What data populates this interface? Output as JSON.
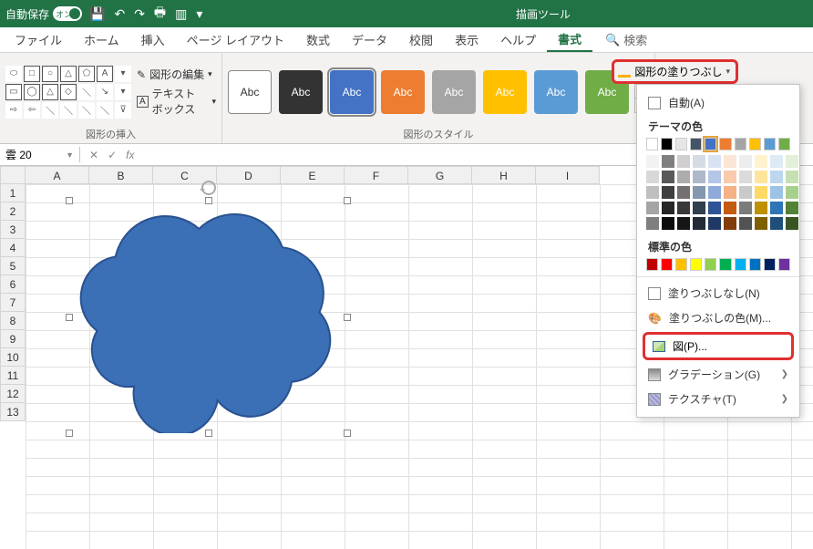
{
  "titlebar": {
    "autosave": "自動保存",
    "toggle_state": "オン",
    "tool_tab": "描画ツール"
  },
  "tabs": {
    "file": "ファイル",
    "home": "ホーム",
    "insert": "挿入",
    "layout": "ページ レイアウト",
    "formula": "数式",
    "data": "データ",
    "review": "校閲",
    "view": "表示",
    "help": "ヘルプ",
    "format": "書式",
    "search": "検索"
  },
  "ribbon": {
    "edit_shape": "図形の編集",
    "textbox": "テキスト ボックス",
    "group_insert": "図形の挿入",
    "group_style": "図形のスタイル",
    "style_label": "Abc",
    "fill_btn": "図形の塗りつぶし"
  },
  "formula": {
    "namebox": "雲 20"
  },
  "columns": [
    "A",
    "B",
    "C",
    "D",
    "E",
    "F",
    "G",
    "H",
    "I"
  ],
  "rows": [
    "1",
    "2",
    "3",
    "4",
    "5",
    "6",
    "7",
    "8",
    "9",
    "10",
    "11",
    "12",
    "13"
  ],
  "dropdown": {
    "auto": "自動(A)",
    "theme": "テーマの色",
    "standard": "標準の色",
    "nofill": "塗りつぶしなし(N)",
    "morecolors": "塗りつぶしの色(M)...",
    "picture": "図(P)...",
    "gradient": "グラデーション(G)",
    "texture": "テクスチャ(T)"
  },
  "chart_data": null
}
